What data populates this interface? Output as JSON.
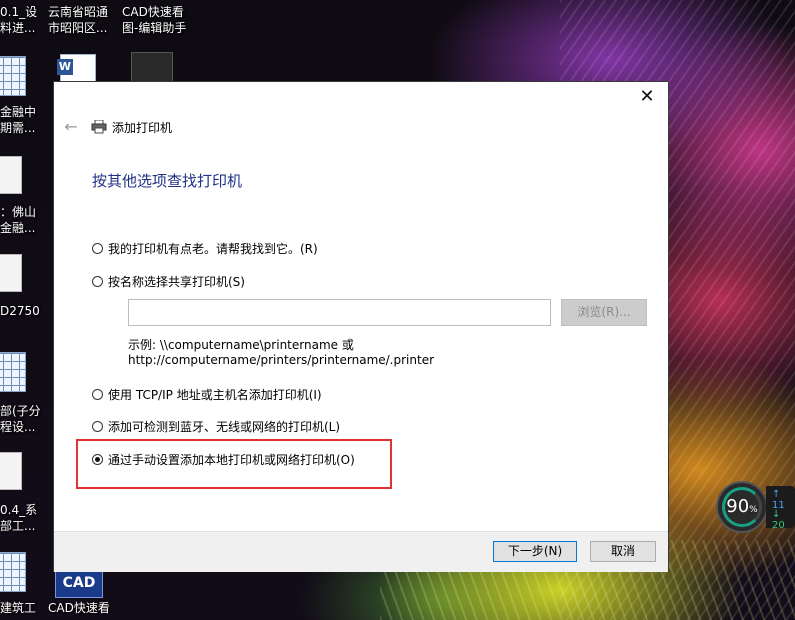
{
  "desktop": {
    "icons": [
      {
        "line1": "0.1_设",
        "line2": "料进..."
      },
      {
        "line1": "云南省昭通",
        "line2": "市昭阳区..."
      },
      {
        "line1": "CAD快速看",
        "line2": "图-编辑助手"
      },
      {
        "line1": "金融中",
        "line2": "期需..."
      },
      {
        "line1": "：佛山",
        "line2": "金融..."
      },
      {
        "line1": "D2750",
        "line2": ""
      },
      {
        "line1": "部(子分",
        "line2": "程设..."
      },
      {
        "line1": "0.4_系",
        "line2": "部工..."
      },
      {
        "line1": "建筑工",
        "line2": ""
      },
      {
        "line1": "CAD快速看",
        "line2": ""
      }
    ],
    "cad_logo_text": "CAD"
  },
  "dialog": {
    "title": "添加打印机",
    "heading": "按其他选项查找打印机",
    "close_glyph": "✕",
    "back_glyph": "←",
    "options": [
      {
        "label": "我的打印机有点老。请帮我找到它。(R)",
        "checked": false
      },
      {
        "label": "按名称选择共享打印机(S)",
        "checked": false
      },
      {
        "label": "使用 TCP/IP 地址或主机名添加打印机(I)",
        "checked": false
      },
      {
        "label": "添加可检测到蓝牙、无线或网络的打印机(L)",
        "checked": false
      },
      {
        "label": "通过手动设置添加本地打印机或网络打印机(O)",
        "checked": true
      }
    ],
    "share_input": {
      "value": "",
      "placeholder": ""
    },
    "browse_label": "浏览(R)...",
    "example_line1": "示例: \\\\computername\\printername 或",
    "example_line2": "http://computername/printers/printername/.printer",
    "next_label": "下一步(N)",
    "cancel_label": "取消"
  },
  "gauge": {
    "value": "90",
    "unit": "%",
    "up_text": "↑ 11",
    "down_text": "↓ 20"
  }
}
